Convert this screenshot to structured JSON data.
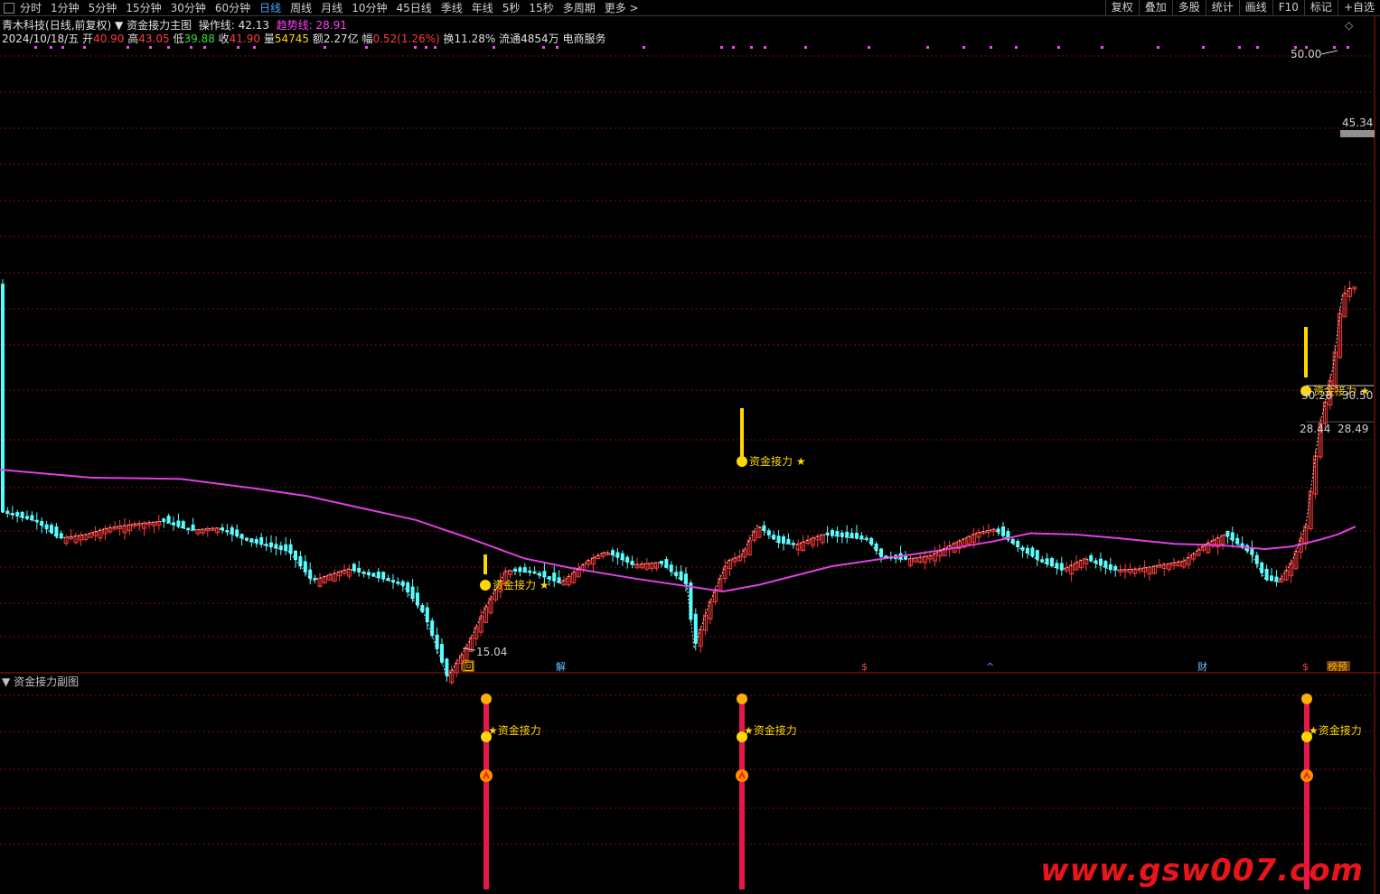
{
  "toolbar": {
    "periods": [
      "分时",
      "1分钟",
      "5分钟",
      "15分钟",
      "30分钟",
      "60分钟",
      "日线",
      "周线",
      "月线",
      "10分钟",
      "45日线",
      "季线",
      "年线",
      "5秒",
      "15秒",
      "多周期",
      "更多 >"
    ],
    "active_period": "日线",
    "right_buttons": [
      "复权",
      "叠加",
      "多股",
      "统计",
      "画线",
      "F10",
      "标记",
      "+自选"
    ]
  },
  "header": {
    "stock_name": "青木科技",
    "mode": "(日线,前复权)",
    "indicator_name": "资金接力主图",
    "op_label": "操作线:",
    "op_value": "42.13",
    "trend_label": "趋势线:",
    "trend_value": "28.91"
  },
  "quote": {
    "date": "2024/10/18/五",
    "open_label": "开",
    "open": "40.90",
    "high_label": "高",
    "high": "43.05",
    "low_label": "低",
    "low": "39.88",
    "close_label": "收",
    "close": "41.90",
    "vol_label": "量",
    "volume": "54745",
    "amt_label": "额",
    "amount": "2.27亿",
    "chg_label": "幅",
    "change": "0.52(1.26%)",
    "turnover_label": "换",
    "turnover": "11.28%",
    "float_label": "流通",
    "float_shares": "4854万",
    "sector": "电商服务"
  },
  "main_chart": {
    "max_label": "50.00",
    "min_label": "15.04",
    "right_labels": [
      "45.34",
      "30.50",
      "28.49"
    ],
    "near_labels": [
      "30.28",
      "28.44"
    ],
    "signal_text": "资金接力",
    "event_markers": [
      "回",
      "解",
      "$",
      "^",
      "财",
      "$",
      "榜预"
    ]
  },
  "sub_chart": {
    "title": "资金接力副图",
    "signal_text": "资金接力"
  },
  "colors": {
    "up": "#ff3b3b",
    "down": "#54ffff",
    "ma": "#e040e0",
    "grid": "#7a1010",
    "signal": "#ffd800",
    "sub_bar": "#e8164a"
  },
  "watermark": "www.gsw007.com"
}
